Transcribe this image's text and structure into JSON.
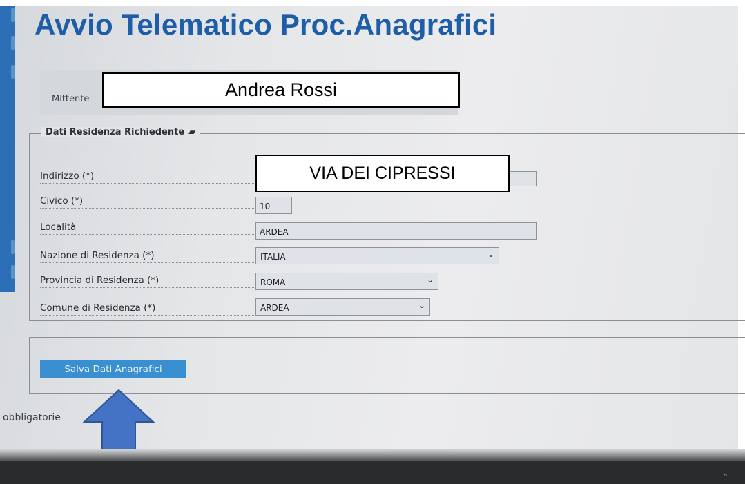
{
  "page": {
    "title": "Avvio Telematico Proc.Anagrafici"
  },
  "mittente": {
    "label": "Mittente",
    "value": "Andrea Rossi"
  },
  "section": {
    "legend": "Dati Residenza Richiedente",
    "icon": "eraser-icon"
  },
  "fields": {
    "indirizzo": {
      "label": "Indirizzo (*)",
      "value": "VIA DEI CIPRESSI"
    },
    "civico": {
      "label": "Civico (*)",
      "value": "10"
    },
    "localita": {
      "label": "Località",
      "value": "ARDEA"
    },
    "nazione": {
      "label": "Nazione di Residenza (*)",
      "value": "ITALIA"
    },
    "provincia": {
      "label": "Provincia di Residenza (*)",
      "value": "ROMA"
    },
    "comune": {
      "label": "Comune di Residenza (*)",
      "value": "ARDEA"
    }
  },
  "actions": {
    "save_label": "Salva Dati Anagrafici"
  },
  "footer": {
    "note": "obbligatorie"
  },
  "colors": {
    "accent": "#1e5ea8",
    "button": "#3a8fd0",
    "arrow": "#4472c4"
  }
}
